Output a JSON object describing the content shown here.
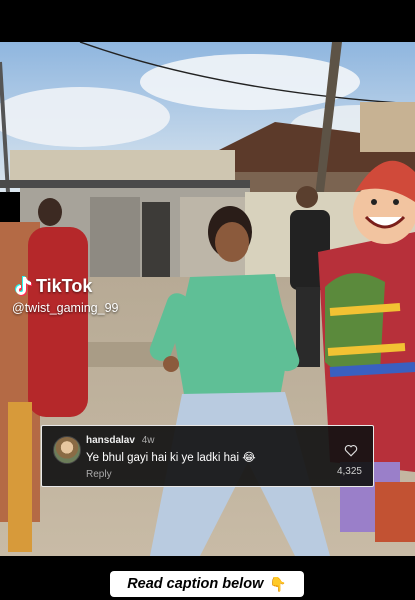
{
  "watermark": {
    "brand": "TikTok",
    "handle": "@twist_gaming_99"
  },
  "comment": {
    "username": "hansdalav",
    "time": "4w",
    "text": "Ye bhul gayi hai ki ye ladki hai 😂",
    "reply_label": "Reply",
    "like_count": "4,325",
    "like_icon": "heart-outline-icon",
    "avatar_icon": "avatar"
  },
  "caption": {
    "text": "Read caption below",
    "emoji": "👇"
  },
  "colors": {
    "tiktok_cyan": "#25F4EE",
    "tiktok_red": "#FE2C55",
    "comment_bg": "#121212"
  }
}
